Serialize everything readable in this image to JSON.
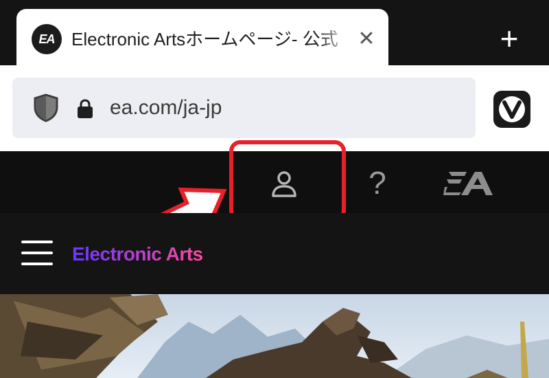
{
  "browser": {
    "tab": {
      "favicon_text": "EA",
      "title": "Electronic Artsホームページ- 公式",
      "close_glyph": "✕"
    },
    "new_tab_glyph": "+",
    "url": "ea.com/ja-jp",
    "icons": [
      "shield-icon",
      "lock-icon",
      "vivaldi-icon",
      "close-icon",
      "plus-icon"
    ]
  },
  "account_bar": {
    "icons": [
      "person-icon",
      "help-icon",
      "ea-logo-icon"
    ],
    "help_glyph": "?"
  },
  "site_header": {
    "brand": "Electronic Arts",
    "menu_icon": "hamburger-menu-icon"
  },
  "annotation": {
    "highlight_color": "#e8202a",
    "target": "person-icon"
  },
  "colors": {
    "brand_gradient_start": "#6a35ff",
    "brand_gradient_end": "#ff4aa0",
    "header_bg": "#0f0f0f"
  }
}
